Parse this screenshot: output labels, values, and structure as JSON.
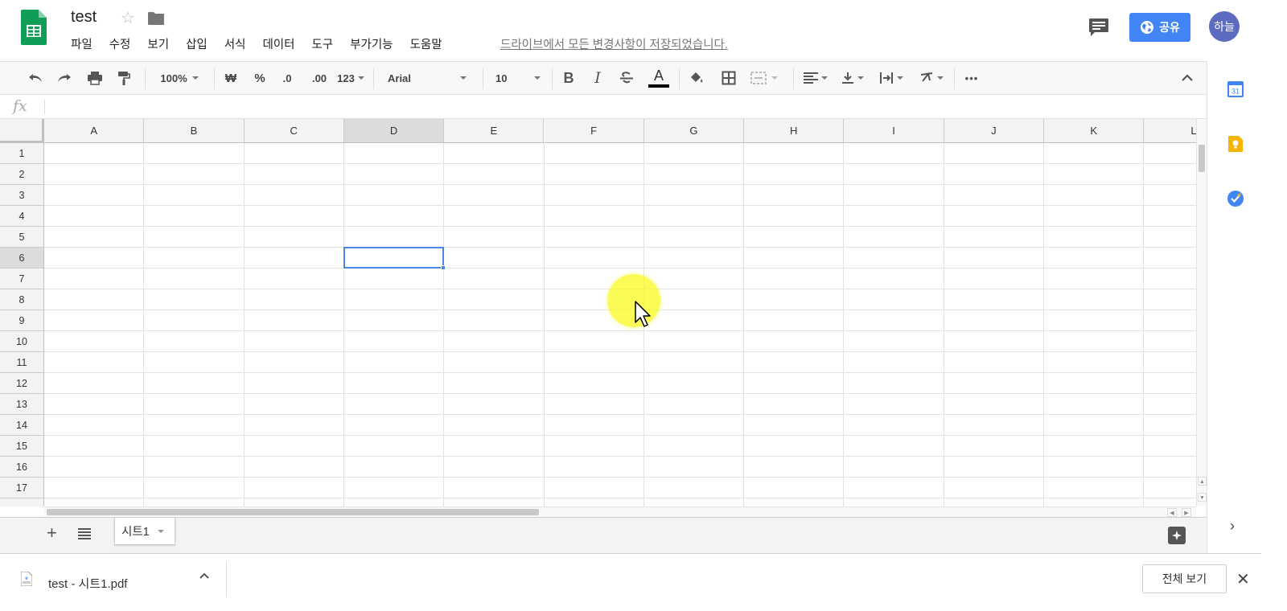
{
  "header": {
    "doc_title": "test",
    "menu": [
      "파일",
      "수정",
      "보기",
      "삽입",
      "서식",
      "데이터",
      "도구",
      "부가기능",
      "도움말"
    ],
    "save_status": "드라이브에서 모든 변경사항이 저장되었습니다.",
    "share_label": "공유",
    "avatar_initials": "하늘",
    "brand_color": "#0f9d58",
    "share_color": "#4285f4"
  },
  "toolbar": {
    "zoom": "100%",
    "currency": "₩",
    "percent": "%",
    "decrease_decimal": ".0",
    "increase_decimal": ".00",
    "number_format": "123",
    "font": "Arial",
    "font_size": "10",
    "bold": "B",
    "italic": "I",
    "text_color_glyph": "A",
    "more": "•••"
  },
  "formula_bar": {
    "fx": "fx"
  },
  "grid": {
    "columns": [
      "A",
      "B",
      "C",
      "D",
      "E",
      "F",
      "G",
      "H",
      "I",
      "J",
      "K",
      "L"
    ],
    "rows": [
      "1",
      "2",
      "3",
      "4",
      "5",
      "6",
      "7",
      "8",
      "9",
      "10",
      "11",
      "12",
      "13",
      "14",
      "15",
      "16",
      "17"
    ],
    "active_column": "D",
    "active_row": "6",
    "selection_color": "#4a86e8"
  },
  "sheets": {
    "tabs": [
      {
        "label": "시트1",
        "active": true
      }
    ]
  },
  "side_panel": {
    "calendar_day": "31",
    "icons": [
      "calendar-icon",
      "keep-icon",
      "tasks-icon",
      "expand-icon"
    ]
  },
  "download_bar": {
    "filename": "test - 시트1.pdf",
    "show_all_label": "전체 보기"
  }
}
